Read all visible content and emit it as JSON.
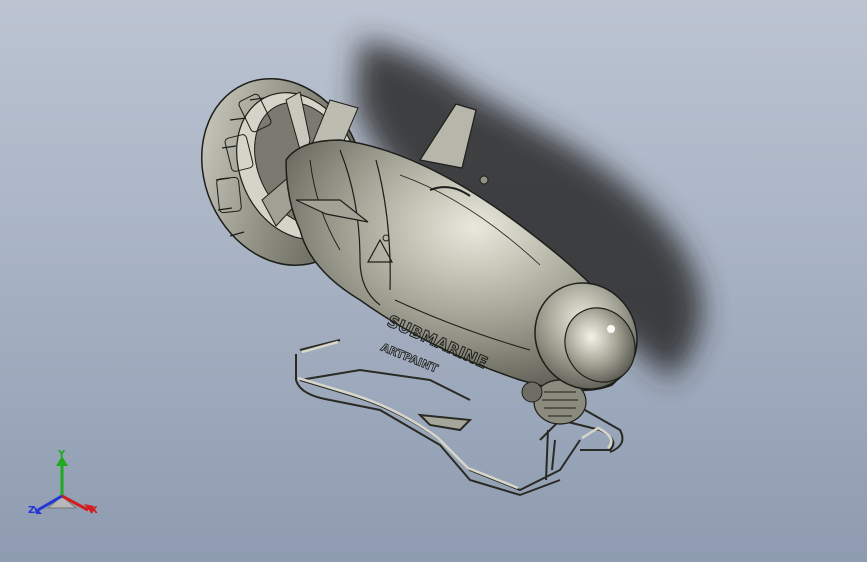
{
  "viewport": {
    "model_name": "submarine-drone-assembly",
    "background_colors": [
      "#bcc4d2",
      "#8e9bb0"
    ],
    "model_color": "#9a9a8c",
    "edge_color": "#1e1e1a"
  },
  "hull_lettering": {
    "main": "SUBMARINE",
    "side": "ARTPAINT"
  },
  "triad": {
    "x_label": "X",
    "y_label": "Y",
    "z_label": "Z",
    "x_color": "#d21e1e",
    "y_color": "#1faa1f",
    "z_color": "#2236d6"
  }
}
